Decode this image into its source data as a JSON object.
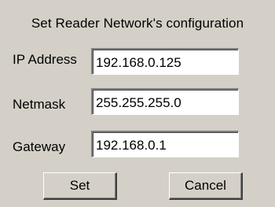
{
  "dialog": {
    "title": "Set Reader Network's configuration",
    "fields": {
      "ip": {
        "label": "IP Address",
        "value": "192.168.0.125"
      },
      "netmask": {
        "label": "Netmask",
        "value": "255.255.255.0"
      },
      "gateway": {
        "label": "Gateway",
        "value": "192.168.0.1"
      }
    },
    "buttons": {
      "set": "Set",
      "cancel": "Cancel"
    }
  }
}
